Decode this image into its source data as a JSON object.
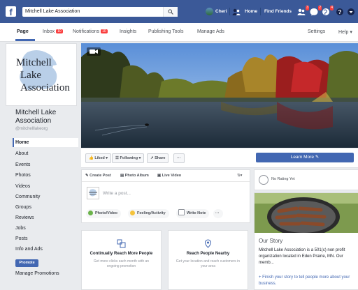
{
  "topbar": {
    "logo": "f",
    "search_value": "Mitchell Lake Association",
    "user_name": "Cheri",
    "home": "Home",
    "find_friends": "Find Friends"
  },
  "pagebar": {
    "tabs": [
      "Page",
      "Inbox",
      "Notifications",
      "Insights",
      "Publishing Tools",
      "Manage Ads"
    ],
    "inbox_badge": "10",
    "notifications_badge": "10",
    "settings": "Settings",
    "help": "Help ▾"
  },
  "left": {
    "logo_lines": [
      "Mitchell",
      "Lake",
      "Association"
    ],
    "page_name": "Mitchell Lake Association",
    "handle": "@mitchelllakeorg",
    "nav": [
      "Home",
      "About",
      "Events",
      "Photos",
      "Videos",
      "Community",
      "Groups",
      "Reviews",
      "Jobs",
      "Posts",
      "Info and Ads"
    ],
    "promote": "Promote",
    "manage_promotions": "Manage Promotions"
  },
  "actions": {
    "liked": "Liked ▾",
    "following": "Following ▾",
    "share": "Share",
    "more": "···",
    "learn_more": "Learn More ✎"
  },
  "composer": {
    "tabs": [
      "Create Post",
      "Photo Album",
      "Live Video"
    ],
    "placeholder": "Write a post...",
    "chips": [
      "Photo/Video",
      "Feeling/Activity",
      "Write Note"
    ],
    "more": "···"
  },
  "cards": [
    {
      "title": "Continually Reach More People",
      "desc": "Get more clicks each month with an ongoing promotion"
    },
    {
      "title": "Reach People Nearby",
      "desc": "Get your location and reach customers in your area"
    }
  ],
  "right": {
    "rating": "No Rating Yet",
    "story_heading": "Our Story",
    "story_text": "Mitchell Lake Association is a 501(c) non profit organization located in Eden Prairie, MN. Our memb...",
    "story_link": "+ Finish your story to tell people more about your business."
  },
  "colors": {
    "brand": "#3b5998",
    "accent": "#4267b2",
    "badge": "#fa3e3e"
  }
}
